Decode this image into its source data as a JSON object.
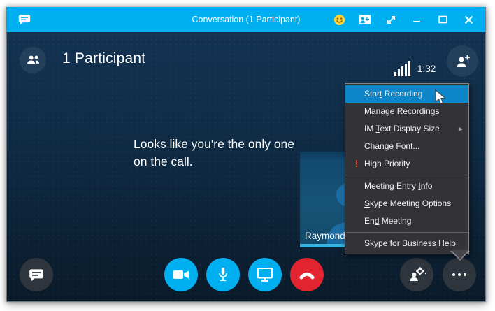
{
  "titlebar": {
    "title": "Conversation (1 Participant)"
  },
  "call_header": {
    "participants_label": "1 Participant",
    "timer": "1:32"
  },
  "stage": {
    "empty_call_message": "Looks like you're the only one on the call.",
    "participant_name": "Raymond"
  },
  "context_menu": {
    "items": [
      {
        "label": "Star&t Recording",
        "highlighted": true,
        "cursor": true
      },
      {
        "label": "&Manage Recordings"
      },
      {
        "label": "IM &Text Display Size",
        "submenu": true
      },
      {
        "label": "Change &Font..."
      },
      {
        "label": "High Priority",
        "icon": "high-priority-exclamation-icon",
        "separator_after": true
      },
      {
        "label": "Meeting Entry &Info"
      },
      {
        "label": "&Skype Meeting Options"
      },
      {
        "label": "En&d Meeting",
        "separator_after": true
      },
      {
        "label": "Skype for Business &Help"
      }
    ]
  },
  "colors": {
    "titlebar_blue": "#00AFF0",
    "accent_blue": "#00AFF0",
    "menu_highlight_blue": "#0C85C9",
    "end_call_red": "#E1242F",
    "high_priority_red": "#E0482F",
    "video_strip_cyan": "#38B1DC",
    "menu_background": "#323237",
    "stage_background_top": "#143351",
    "stage_background_bottom": "#0A1A29"
  }
}
